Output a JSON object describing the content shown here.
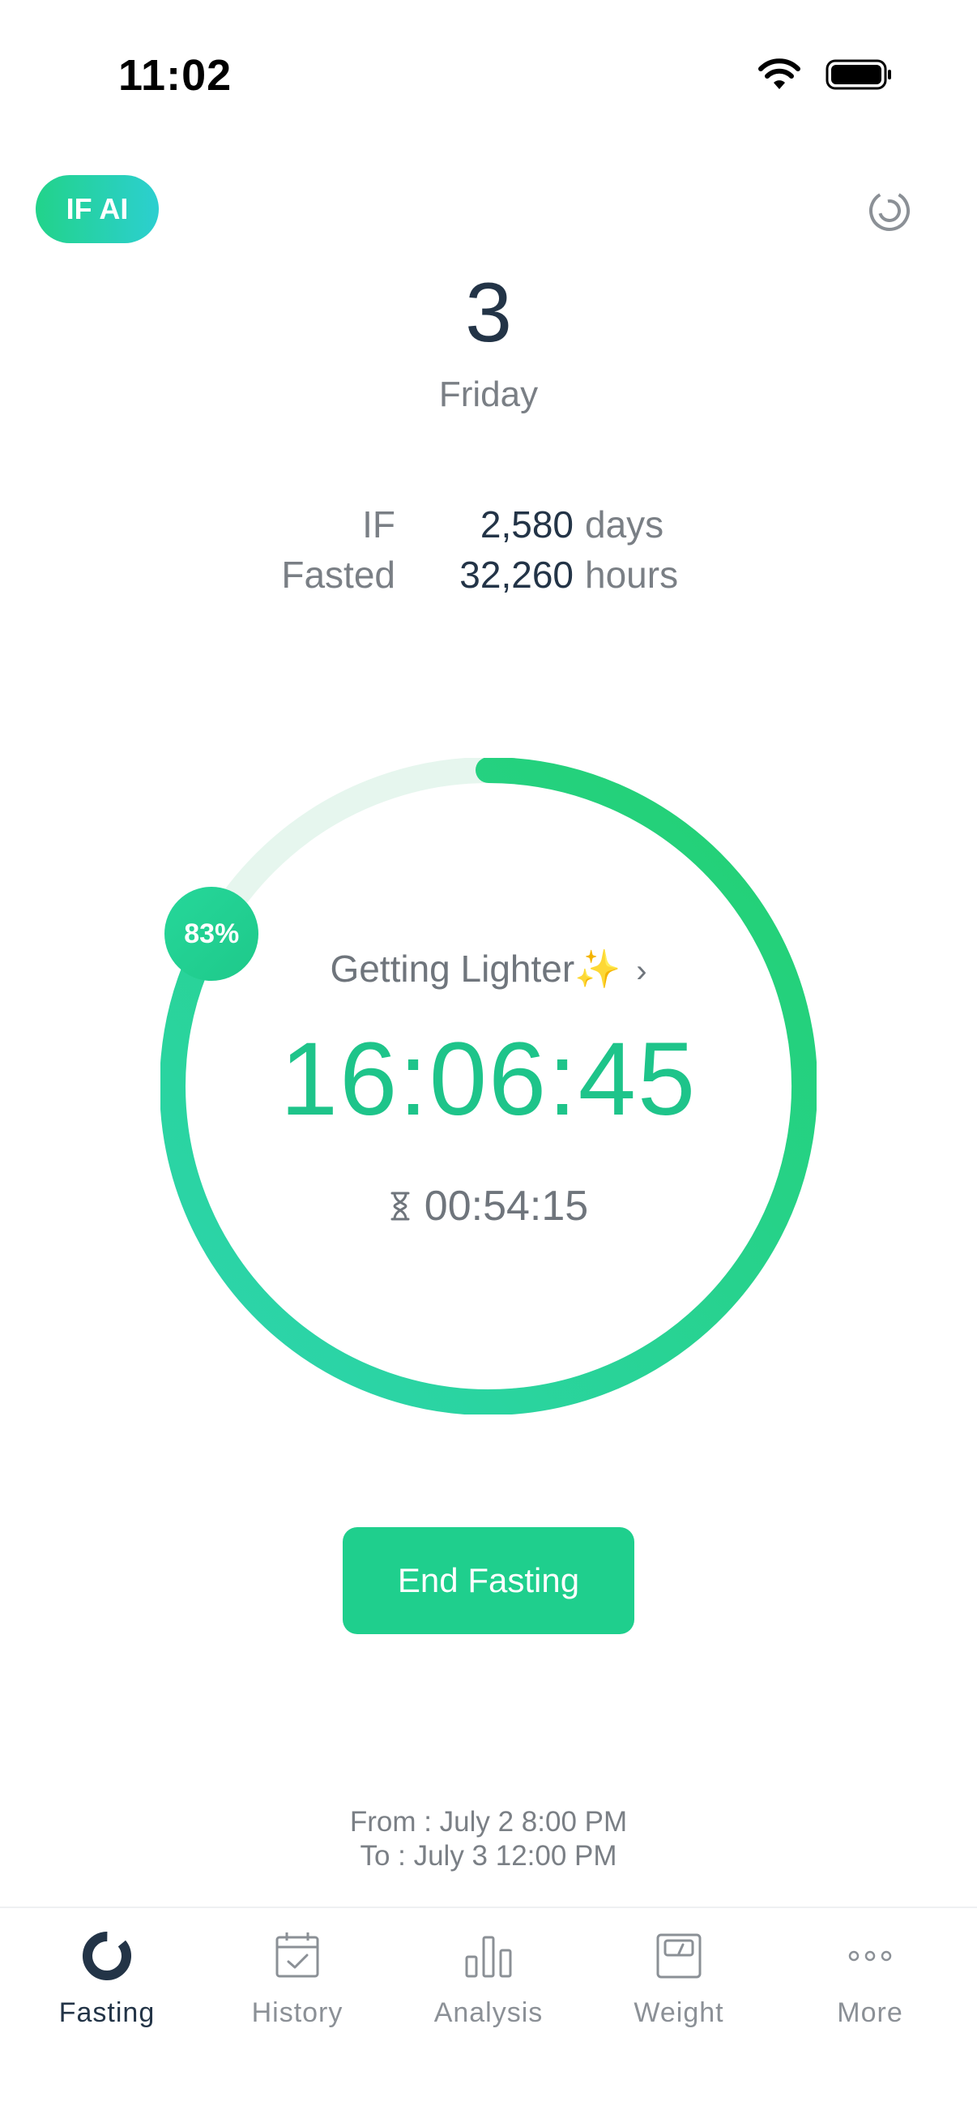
{
  "status_bar": {
    "time": "11:02"
  },
  "header": {
    "ai_button_label": "IF AI",
    "timer_icon": "timer-icon"
  },
  "date": {
    "day": "3",
    "weekday": "Friday"
  },
  "stats": [
    {
      "label": "IF",
      "value": "2,580",
      "unit": "days"
    },
    {
      "label": "Fasted",
      "value": "32,260",
      "unit": "hours"
    }
  ],
  "ring": {
    "progress": 0.83,
    "percent_label": "83%",
    "stage_label": "Getting Lighter✨",
    "elapsed": "16:06:45",
    "remaining": "00:54:15",
    "colors": {
      "start": "#1ec98a",
      "mid": "#2dd5b0",
      "end": "#22d070",
      "track": "#e6f6ee"
    }
  },
  "actions": {
    "end_button_label": "End Fasting"
  },
  "range": {
    "from": "From : July 2 8:00 PM",
    "to": "To : July 3 12:00 PM"
  },
  "tabs": [
    {
      "label": "Fasting",
      "icon": "fasting-ring-icon",
      "active": true
    },
    {
      "label": "History",
      "icon": "calendar-check-icon",
      "active": false
    },
    {
      "label": "Analysis",
      "icon": "bar-chart-icon",
      "active": false
    },
    {
      "label": "Weight",
      "icon": "scale-icon",
      "active": false
    },
    {
      "label": "More",
      "icon": "more-dots-icon",
      "active": false
    }
  ]
}
